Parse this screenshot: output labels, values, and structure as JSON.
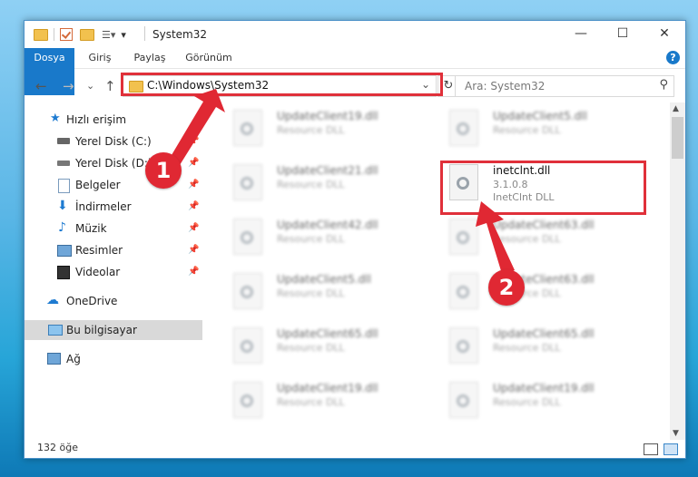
{
  "window": {
    "title": "System32",
    "minimize": "—",
    "maximize": "☐",
    "close": "✕"
  },
  "ribbon": {
    "tabs": [
      "Dosya",
      "Giriş",
      "Paylaş",
      "Görünüm"
    ],
    "help": "?"
  },
  "nav": {
    "back": "←",
    "forward": "→",
    "recent": "⌄",
    "up": "↑",
    "address": "C:\\Windows\\System32",
    "refresh": "↻",
    "search_placeholder": "Ara: System32"
  },
  "sidebar": {
    "quick_access": "Hızlı erişim",
    "items": [
      {
        "label": "Yerel Disk (C:)"
      },
      {
        "label": "Yerel Disk (D:)"
      },
      {
        "label": "Belgeler"
      },
      {
        "label": "İndirmeler"
      },
      {
        "label": "Müzik"
      },
      {
        "label": "Resimler"
      },
      {
        "label": "Videolar"
      }
    ],
    "onedrive": "OneDrive",
    "this_pc": "Bu bilgisayar",
    "network": "Ağ"
  },
  "files": {
    "left": [
      {
        "name": "UpdateClient19.dll",
        "type": "Resource DLL"
      },
      {
        "name": "UpdateClient21.dll",
        "type": "Resource DLL"
      },
      {
        "name": "UpdateClient42.dll",
        "type": "Resource DLL"
      },
      {
        "name": "UpdateClient5.dll",
        "type": "Resource DLL"
      },
      {
        "name": "UpdateClient65.dll",
        "type": "Resource DLL"
      },
      {
        "name": "UpdateClient19.dll",
        "type": "Resource DLL"
      }
    ],
    "right": [
      {
        "name": "UpdateClient5.dll",
        "type": "Resource DLL"
      },
      {
        "name": "UpdateClient63.dll",
        "type": "Resource DLL"
      },
      {
        "name": "UpdateClient63.dll",
        "type": "Resource DLL"
      },
      {
        "name": "UpdateClient65.dll",
        "type": "Resource DLL"
      },
      {
        "name": "UpdateClient19.dll",
        "type": "Resource DLL"
      }
    ],
    "highlighted": {
      "name": "inetclnt.dll",
      "version": "3.1.0.8",
      "type": "InetClnt DLL"
    }
  },
  "status": {
    "count": "132 öğe"
  },
  "annotations": {
    "badge1": "1",
    "badge2": "2",
    "highlight_color": "#e0303a"
  }
}
